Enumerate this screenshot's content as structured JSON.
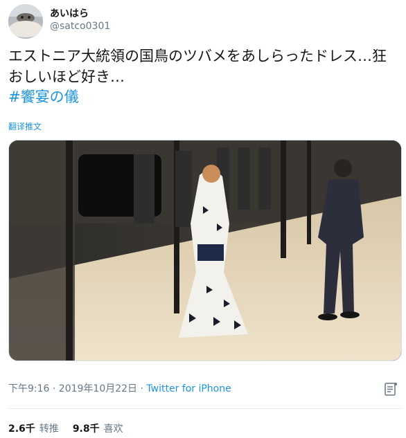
{
  "user": {
    "display_name": "あいはら",
    "handle": "@satco0301"
  },
  "tweet": {
    "text": "エストニア大統領の国鳥のツバメをあしらったドレス…狂おしいほど好き…",
    "hashtag": "#饗宴の儀",
    "translate_label": "翻译推文"
  },
  "meta": {
    "timestamp": "下午9:16 · 2019年10月22日",
    "separator": " · ",
    "source": "Twitter for iPhone"
  },
  "stats": {
    "retweets_count": "2.6千",
    "retweets_label": "转推",
    "likes_count": "9.8千",
    "likes_label": "喜欢"
  },
  "icons": [
    "avatar",
    "photo",
    "document-icon"
  ],
  "colors": {
    "link": "#1b95e0",
    "secondary": "#657786",
    "text": "#14171a"
  }
}
